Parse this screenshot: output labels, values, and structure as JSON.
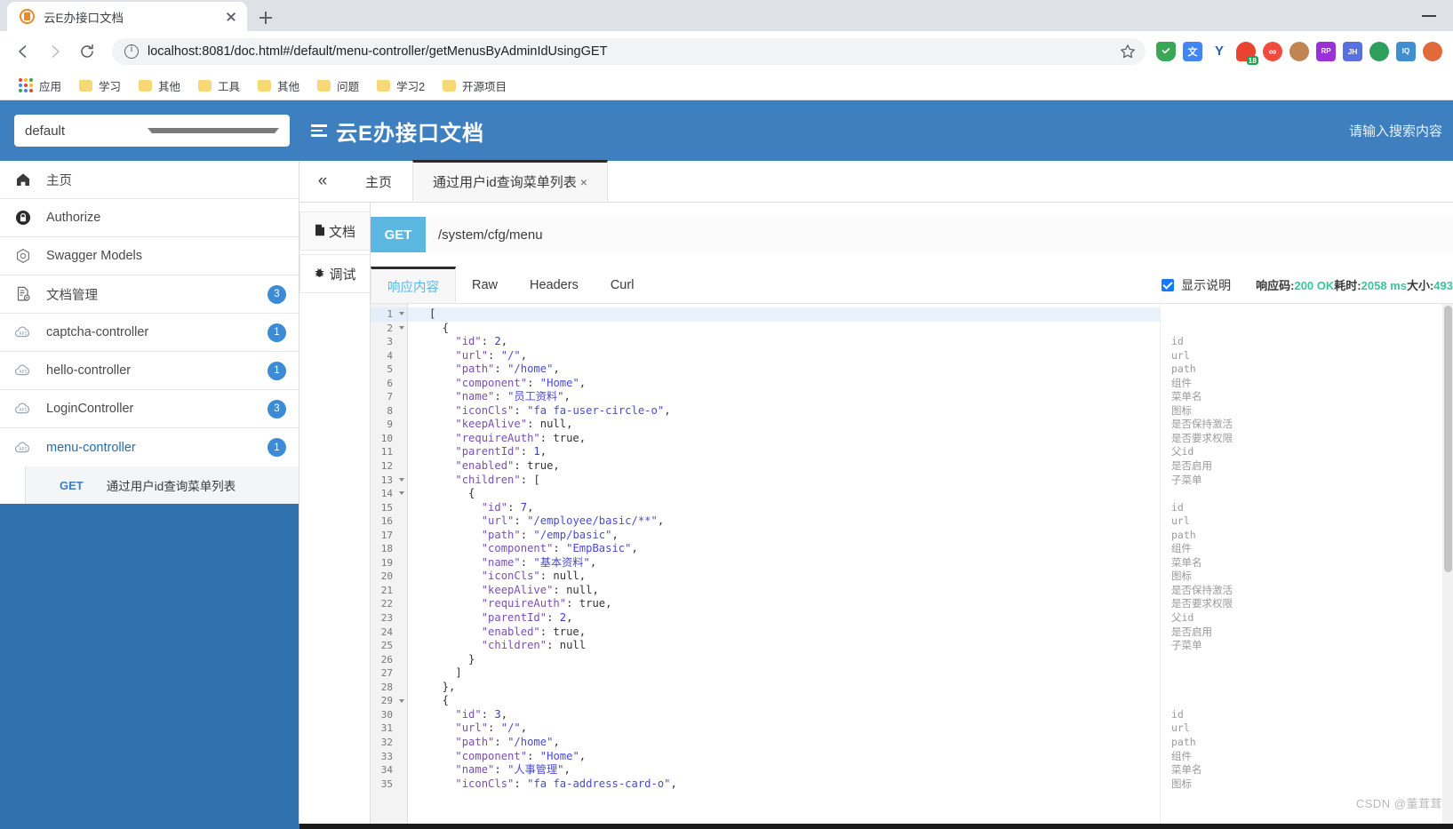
{
  "browser": {
    "tab_title": "云E办接口文档",
    "tab_close_label": "×",
    "new_tab_label": "+",
    "minimize_label": "—",
    "url": "localhost:8081/doc.html#/default/menu-controller/getMenusByAdminIdUsingGET",
    "nav": {
      "back": "back-arrow",
      "forward": "forward-arrow",
      "reload": "reload-icon",
      "info": "site-info-icon",
      "star": "bookmark-star-icon"
    },
    "bookmarks": [
      {
        "label": "应用",
        "icon": "apps-grid-icon"
      },
      {
        "label": "学习",
        "icon": "folder-icon"
      },
      {
        "label": "其他",
        "icon": "folder-icon"
      },
      {
        "label": "工具",
        "icon": "folder-icon"
      },
      {
        "label": "其他",
        "icon": "folder-icon"
      },
      {
        "label": "问题",
        "icon": "folder-icon"
      },
      {
        "label": "学习2",
        "icon": "folder-icon"
      },
      {
        "label": "开源项目",
        "icon": "folder-icon"
      }
    ],
    "extensions": [
      {
        "name": "adblock-shield-icon",
        "glyph": "",
        "color": "#3aa757"
      },
      {
        "name": "translate-icon",
        "glyph": "文",
        "color": "#4285f4"
      },
      {
        "name": "yandex-icon",
        "glyph": "Y",
        "color": "#2a5db0"
      },
      {
        "name": "notification-badge-icon",
        "glyph": "18",
        "color": "#e8442f"
      },
      {
        "name": "infinity-icon",
        "glyph": "∞",
        "color": "#f04b3c"
      },
      {
        "name": "monkey-icon",
        "glyph": "",
        "color": "#c08552"
      },
      {
        "name": "rp-icon",
        "glyph": "RP",
        "color": "#9b30d9"
      },
      {
        "name": "jh-icon",
        "glyph": "JH",
        "color": "#5a6fe0"
      },
      {
        "name": "globe-icon",
        "glyph": "",
        "color": "#2ca05a"
      },
      {
        "name": "reader-icon",
        "glyph": "IQ",
        "color": "#3f8fd0"
      },
      {
        "name": "sitemap-icon",
        "glyph": "",
        "color": "#e06a3a"
      }
    ]
  },
  "app": {
    "env_value": "default",
    "env_options": [
      "default"
    ],
    "brand_title": "云E办接口文档",
    "menu_icon": "hamburger-icon",
    "search_placeholder": "请输入搜索内容"
  },
  "sidebar": {
    "items": [
      {
        "label": "主页",
        "icon": "home-icon",
        "badge": "",
        "link": false
      },
      {
        "label": "Authorize",
        "icon": "lock-icon",
        "badge": "",
        "link": false
      },
      {
        "label": "Swagger Models",
        "icon": "cube-icon",
        "badge": "",
        "link": false
      },
      {
        "label": "文档管理",
        "icon": "doc-settings-icon",
        "badge": "3",
        "link": false
      },
      {
        "label": "captcha-controller",
        "icon": "api-cloud-icon",
        "badge": "1",
        "link": false
      },
      {
        "label": "hello-controller",
        "icon": "api-cloud-icon",
        "badge": "1",
        "link": false
      },
      {
        "label": "LoginController",
        "icon": "api-cloud-icon",
        "badge": "3",
        "link": false
      },
      {
        "label": "menu-controller",
        "icon": "api-cloud-icon",
        "badge": "1",
        "link": true
      }
    ],
    "api_rows": [
      {
        "method": "GET",
        "name": "通过用户id查询菜单列表"
      }
    ]
  },
  "main": {
    "collapse_icon": "collapse-left-icon",
    "doc_tabs": [
      {
        "label": "主页",
        "active": false,
        "closable": false
      },
      {
        "label": "通过用户id查询菜单列表",
        "active": true,
        "closable": true,
        "close": "×"
      }
    ],
    "vtabs": [
      {
        "label": "文档",
        "icon": "document-icon",
        "active": false
      },
      {
        "label": "调试",
        "icon": "bug-icon",
        "active": true
      }
    ],
    "request": {
      "method": "GET",
      "url": "/system/cfg/menu"
    },
    "resp_tabs": [
      {
        "label": "响应内容",
        "active": true
      },
      {
        "label": "Raw",
        "active": false
      },
      {
        "label": "Headers",
        "active": false
      },
      {
        "label": "Curl",
        "active": false
      }
    ],
    "show_desc_label": "显示说明",
    "show_desc_checked": true,
    "meta": {
      "status_label": "响应码:",
      "status_value": "200 OK",
      "time_label": "耗时:",
      "time_value": "2058 ms",
      "size_label": "大小:",
      "size_value": "493"
    }
  },
  "code": {
    "lines": [
      {
        "n": 1,
        "fold": true,
        "text": "["
      },
      {
        "n": 2,
        "fold": true,
        "text": "  {"
      },
      {
        "n": 3,
        "fold": false,
        "text": "    \"id\": 2,"
      },
      {
        "n": 4,
        "fold": false,
        "text": "    \"url\": \"/\","
      },
      {
        "n": 5,
        "fold": false,
        "text": "    \"path\": \"/home\","
      },
      {
        "n": 6,
        "fold": false,
        "text": "    \"component\": \"Home\","
      },
      {
        "n": 7,
        "fold": false,
        "text": "    \"name\": \"员工资料\","
      },
      {
        "n": 8,
        "fold": false,
        "text": "    \"iconCls\": \"fa fa-user-circle-o\","
      },
      {
        "n": 9,
        "fold": false,
        "text": "    \"keepAlive\": null,"
      },
      {
        "n": 10,
        "fold": false,
        "text": "    \"requireAuth\": true,"
      },
      {
        "n": 11,
        "fold": false,
        "text": "    \"parentId\": 1,"
      },
      {
        "n": 12,
        "fold": false,
        "text": "    \"enabled\": true,"
      },
      {
        "n": 13,
        "fold": true,
        "text": "    \"children\": ["
      },
      {
        "n": 14,
        "fold": true,
        "text": "      {"
      },
      {
        "n": 15,
        "fold": false,
        "text": "        \"id\": 7,"
      },
      {
        "n": 16,
        "fold": false,
        "text": "        \"url\": \"/employee/basic/**\","
      },
      {
        "n": 17,
        "fold": false,
        "text": "        \"path\": \"/emp/basic\","
      },
      {
        "n": 18,
        "fold": false,
        "text": "        \"component\": \"EmpBasic\","
      },
      {
        "n": 19,
        "fold": false,
        "text": "        \"name\": \"基本资料\","
      },
      {
        "n": 20,
        "fold": false,
        "text": "        \"iconCls\": null,"
      },
      {
        "n": 21,
        "fold": false,
        "text": "        \"keepAlive\": null,"
      },
      {
        "n": 22,
        "fold": false,
        "text": "        \"requireAuth\": true,"
      },
      {
        "n": 23,
        "fold": false,
        "text": "        \"parentId\": 2,"
      },
      {
        "n": 24,
        "fold": false,
        "text": "        \"enabled\": true,"
      },
      {
        "n": 25,
        "fold": false,
        "text": "        \"children\": null"
      },
      {
        "n": 26,
        "fold": false,
        "text": "      }"
      },
      {
        "n": 27,
        "fold": false,
        "text": "    ]"
      },
      {
        "n": 28,
        "fold": false,
        "text": "  },"
      },
      {
        "n": 29,
        "fold": true,
        "text": "  {"
      },
      {
        "n": 30,
        "fold": false,
        "text": "    \"id\": 3,"
      },
      {
        "n": 31,
        "fold": false,
        "text": "    \"url\": \"/\","
      },
      {
        "n": 32,
        "fold": false,
        "text": "    \"path\": \"/home\","
      },
      {
        "n": 33,
        "fold": false,
        "text": "    \"component\": \"Home\","
      },
      {
        "n": 34,
        "fold": false,
        "text": "    \"name\": \"人事管理\","
      },
      {
        "n": 35,
        "fold": false,
        "text": "    \"iconCls\": \"fa fa-address-card-o\","
      }
    ],
    "annotations": [
      {
        "n": 3,
        "text": "id"
      },
      {
        "n": 4,
        "text": "url"
      },
      {
        "n": 5,
        "text": "path"
      },
      {
        "n": 6,
        "text": "组件"
      },
      {
        "n": 7,
        "text": "菜单名"
      },
      {
        "n": 8,
        "text": "图标"
      },
      {
        "n": 9,
        "text": "是否保持激活"
      },
      {
        "n": 10,
        "text": "是否要求权限"
      },
      {
        "n": 11,
        "text": "父id"
      },
      {
        "n": 12,
        "text": "是否启用"
      },
      {
        "n": 13,
        "text": "子菜单"
      },
      {
        "n": 15,
        "text": "id"
      },
      {
        "n": 16,
        "text": "url"
      },
      {
        "n": 17,
        "text": "path"
      },
      {
        "n": 18,
        "text": "组件"
      },
      {
        "n": 19,
        "text": "菜单名"
      },
      {
        "n": 20,
        "text": "图标"
      },
      {
        "n": 21,
        "text": "是否保持激活"
      },
      {
        "n": 22,
        "text": "是否要求权限"
      },
      {
        "n": 23,
        "text": "父id"
      },
      {
        "n": 24,
        "text": "是否启用"
      },
      {
        "n": 25,
        "text": "子菜单"
      },
      {
        "n": 30,
        "text": "id"
      },
      {
        "n": 31,
        "text": "url"
      },
      {
        "n": 32,
        "text": "path"
      },
      {
        "n": 33,
        "text": "组件"
      },
      {
        "n": 34,
        "text": "菜单名"
      },
      {
        "n": 35,
        "text": "图标"
      }
    ]
  },
  "watermark": "CSDN @董茸茸",
  "colors": {
    "brand_blue": "#3d7fbf",
    "accent_blue": "#2f72ae",
    "method_get": "#5cb8e0",
    "badge": "#3d8bd4",
    "status_green": "#3ec49a"
  }
}
